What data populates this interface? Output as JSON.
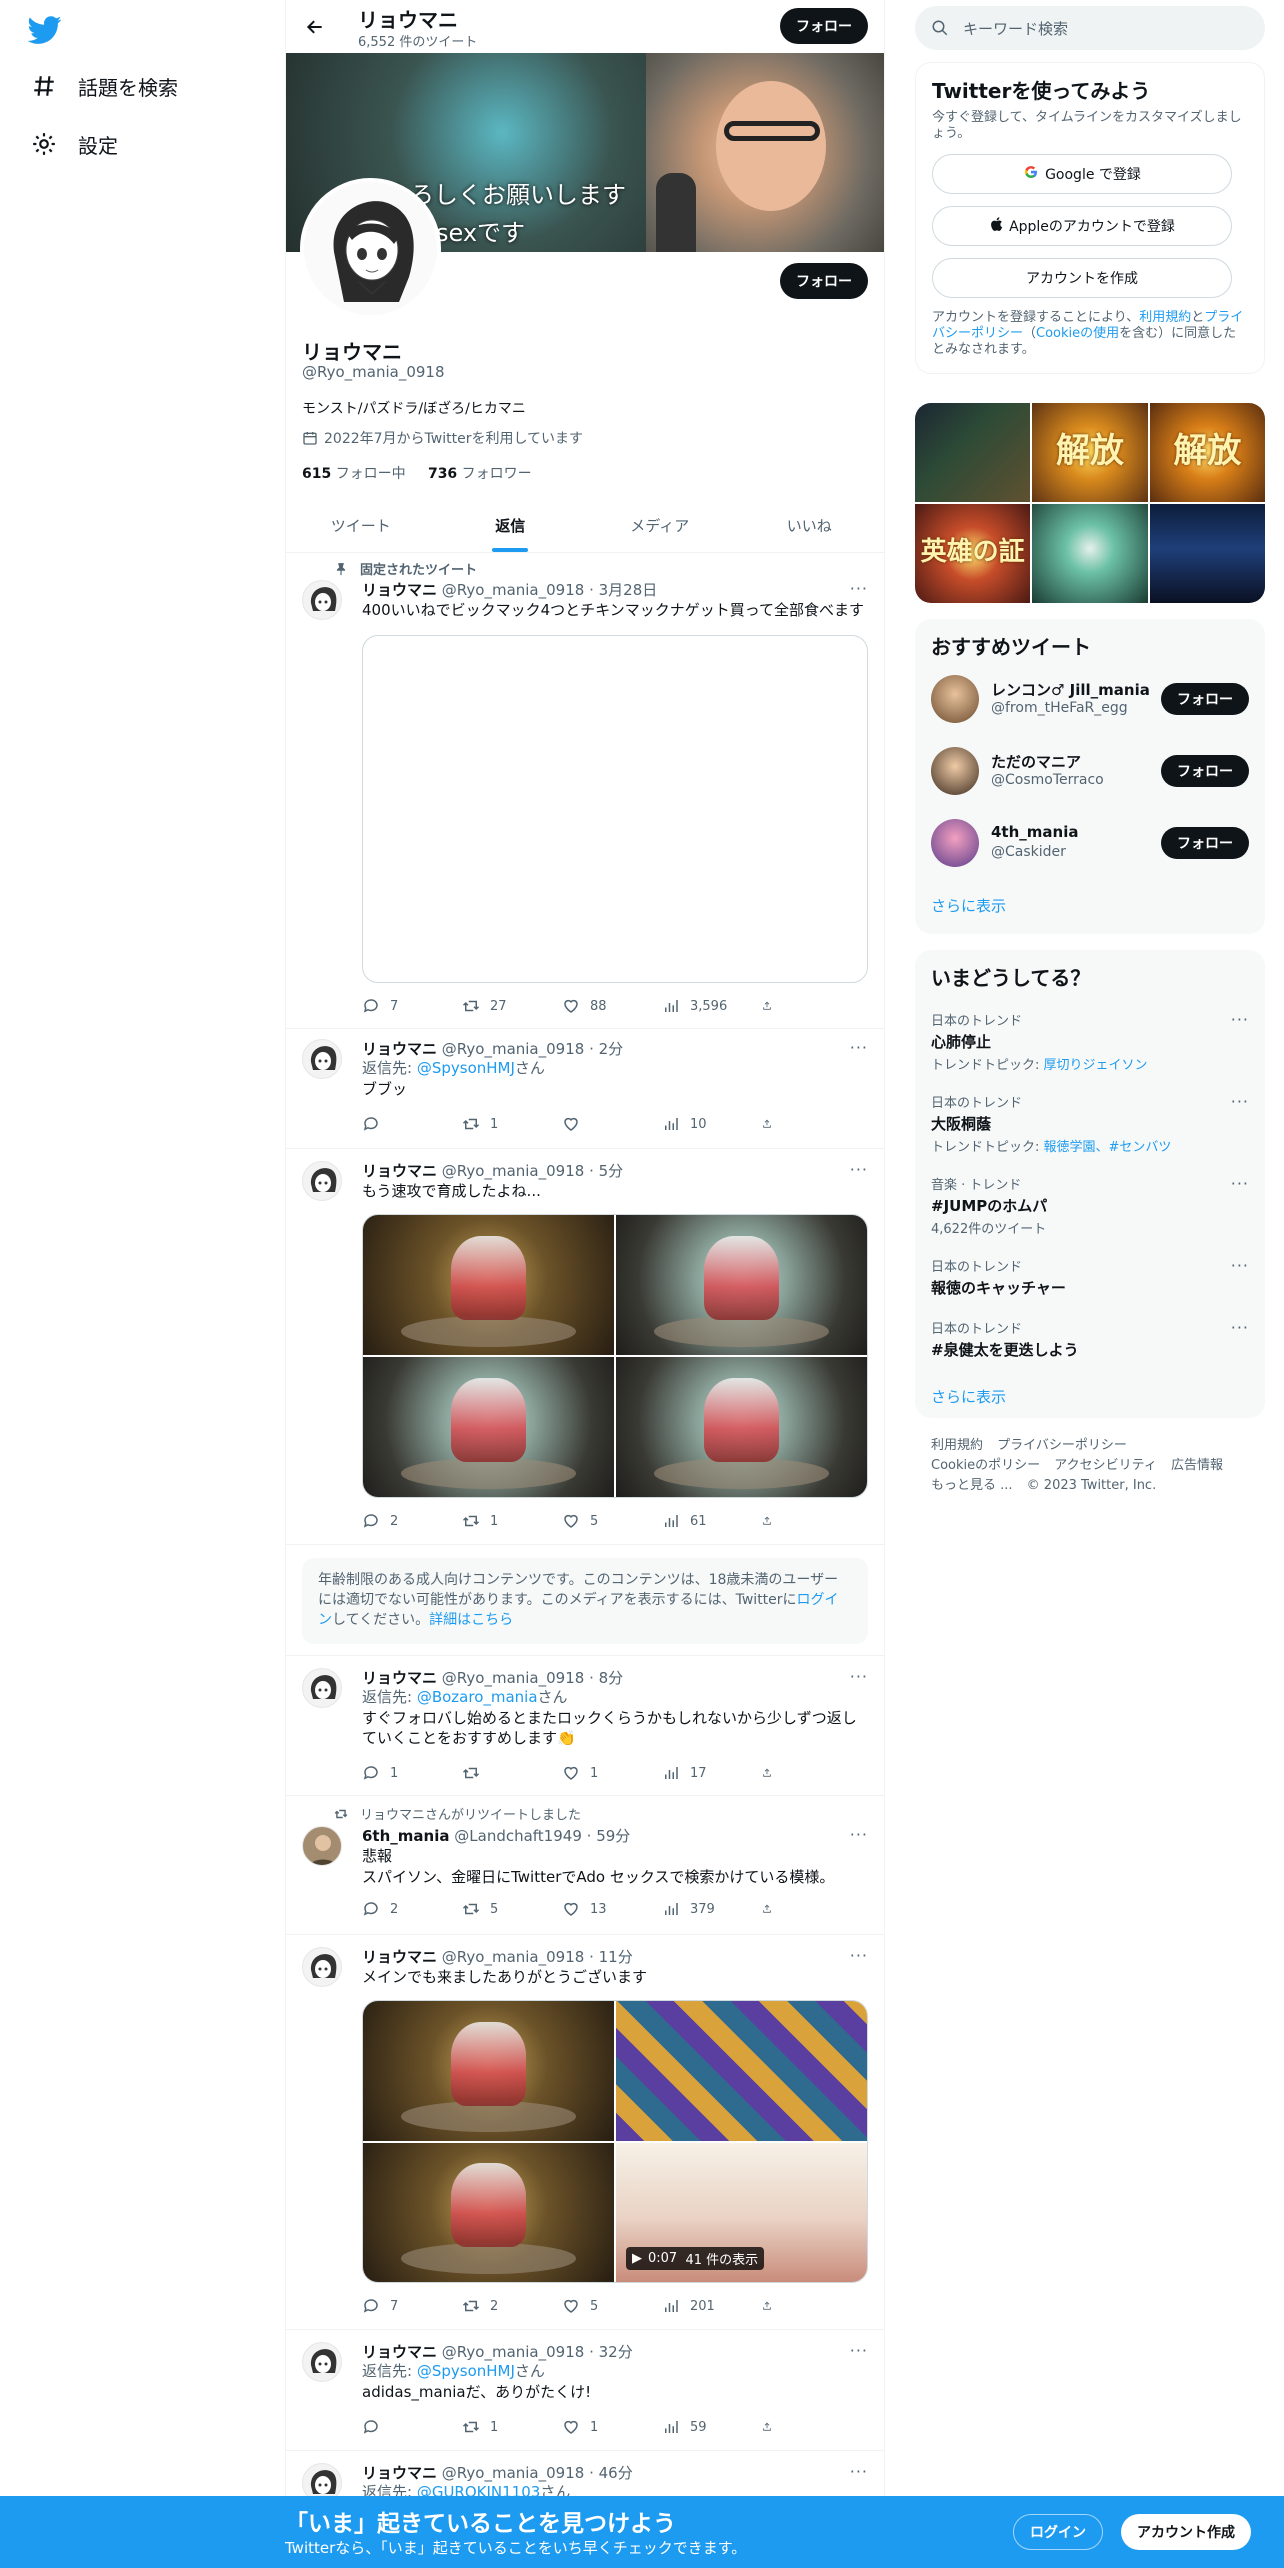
{
  "nav": {
    "explore": "話題を検索",
    "settings": "設定"
  },
  "header": {
    "name": "リョウマニ",
    "tweet_count": "6,552 件のツイート",
    "follow": "フォロー"
  },
  "banner": {
    "caption1": "よろしくお願いします",
    "caption2": "sexです"
  },
  "profile": {
    "name": "リョウマニ",
    "handle": "@Ryo_mania_0918",
    "bio": "モンスト/パズドラ/ぼざろ/ヒカマニ",
    "joined": "2022年7月からTwitterを利用しています",
    "following_count": "615",
    "following_label": "フォロー中",
    "followers_count": "736",
    "followers_label": "フォロワー",
    "follow": "フォロー"
  },
  "tabs": [
    "ツイート",
    "返信",
    "メディア",
    "いいね"
  ],
  "tweets": [
    {
      "pinned_label": "固定されたツイート",
      "name": "リョウマニ",
      "handle": "@Ryo_mania_0918",
      "time": "· 3月28日",
      "text": "400いいねでビックマック4つとチキンマックナゲット買って全部食べます",
      "replies": "7",
      "retweets": "27",
      "likes": "88",
      "views": "3,596"
    },
    {
      "name": "リョウマニ",
      "handle": "@Ryo_mania_0918",
      "time": "· 2分",
      "reply_prefix": "返信先: ",
      "reply_to": "@SpysonHMJ",
      "reply_suffix": "さん",
      "text": "ブブッ",
      "replies": "",
      "retweets": "1",
      "likes": "",
      "views": "10"
    },
    {
      "name": "リョウマニ",
      "handle": "@Ryo_mania_0918",
      "time": "· 5分",
      "text": "もう速攻で育成したよね...",
      "replies": "2",
      "retweets": "1",
      "likes": "5",
      "views": "61"
    },
    {
      "name": "リョウマニ",
      "handle": "@Ryo_mania_0918",
      "time": "· 8分",
      "reply_prefix": "返信先: ",
      "reply_to": "@Bozaro_mania",
      "reply_suffix": "さん",
      "text": "すぐフォロバし始めるとまたロックくらうかもしれないから少しずつ返していくことをおすすめします👏",
      "replies": "1",
      "retweets": "",
      "likes": "1",
      "views": "17"
    },
    {
      "rt_label": "リョウマニさんがリツイートしました",
      "name": "6th_mania",
      "handle": "@Landchaft1949",
      "time": "· 59分",
      "text1": "悲報",
      "text2": "スパイソン、金曜日にTwitterでAdo セックスで検索かけている模様。",
      "replies": "2",
      "retweets": "5",
      "likes": "13",
      "views": "379"
    },
    {
      "name": "リョウマニ",
      "handle": "@Ryo_mania_0918",
      "time": "· 11分",
      "text": "メインでも来ましたありがとうございます",
      "video_time": "0:07",
      "video_views": "41 件の表示",
      "replies": "7",
      "retweets": "2",
      "likes": "5",
      "views": "201"
    },
    {
      "name": "リョウマニ",
      "handle": "@Ryo_mania_0918",
      "time": "· 32分",
      "reply_prefix": "返信先: ",
      "reply_to": "@SpysonHMJ",
      "reply_suffix": "さん",
      "text": "adidas_maniaだ、ありがたくけ!",
      "replies": "",
      "retweets": "1",
      "likes": "1",
      "views": "59"
    },
    {
      "name": "リョウマニ",
      "handle": "@Ryo_mania_0918",
      "time": "· 46分",
      "reply_prefix": "返信先: ",
      "reply_to": "@GUROKIN1103",
      "reply_suffix": "さん"
    }
  ],
  "age_notice": {
    "text": "年齢制限のある成人向けコンテンツです。このコンテンツは、18歳未満のユーザーには適切でない可能性があります。このメディアを表示するには、Twitterに",
    "login": "ログイン",
    "mid": "してください。",
    "details": "詳細はこちら"
  },
  "right": {
    "search_placeholder": "キーワード検索",
    "signup": {
      "title": "Twitterを使ってみよう",
      "subtitle": "今すぐ登録して、タイムラインをカスタマイズしましょう。",
      "google": "Google で登録",
      "apple": "Appleのアカウントで登録",
      "create": "アカウントを作成",
      "terms1": "アカウントを登録することにより、",
      "terms_link1": "利用規約",
      "terms2": "と",
      "terms_link2": "プライバシーポリシー",
      "terms3": "（",
      "terms_link3": "Cookieの使用",
      "terms4": "を含む）に同意したとみなされます。"
    },
    "photo_texts": [
      "解放",
      "解放",
      "英雄の証"
    ],
    "reco": {
      "title": "おすすめツイート",
      "users": [
        {
          "name": "レンコン♂ Jill_mania",
          "handle": "@from_tHeFaR_egg",
          "follow": "フォロー"
        },
        {
          "name": "ただのマニア",
          "handle": "@CosmoTerraco",
          "follow": "フォロー"
        },
        {
          "name": "4th_mania",
          "handle": "@Caskider",
          "follow": "フォロー"
        }
      ],
      "more": "さらに表示"
    },
    "trends": {
      "title": "いまどうしてる？",
      "items": [
        {
          "context": "日本のトレンド",
          "title": "心肺停止",
          "topic_label": "トレンドトピック: ",
          "topic": "厚切りジェイソン"
        },
        {
          "context": "日本のトレンド",
          "title": "大阪桐蔭",
          "topic_label": "トレンドトピック: ",
          "topic": "報徳学園、#センバツ"
        },
        {
          "context": "音楽 · トレンド",
          "title": "#JUMPのホムパ",
          "count": "4,622件のツイート"
        },
        {
          "context": "日本のトレンド",
          "title": "報徳のキャッチャー"
        },
        {
          "context": "日本のトレンド",
          "title": "#泉健太を更迭しよう"
        }
      ],
      "more": "さらに表示"
    },
    "footer": [
      "利用規約",
      "プライバシーポリシー",
      "Cookieのポリシー",
      "アクセシビリティ",
      "広告情報",
      "もっと見る ...",
      "© 2023 Twitter, Inc."
    ]
  },
  "bottombar": {
    "title": "「いま」起きていることを見つけよう",
    "subtitle": "Twitterなら、「いま」起きていることをいち早くチェックできます。",
    "login": "ログイン",
    "signup": "アカウント作成"
  },
  "colors": {
    "accent": "#1d9bf0",
    "text": "#0f1419",
    "muted": "#536471",
    "button_dark": "#0f1419"
  }
}
